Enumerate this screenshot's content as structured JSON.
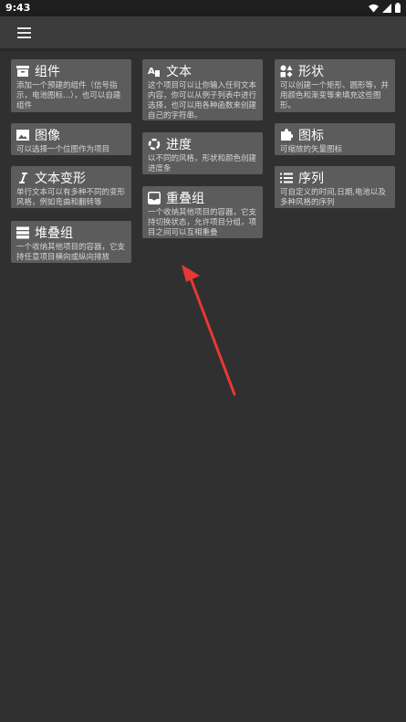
{
  "status": {
    "time": "9:43"
  },
  "cards": {
    "components": {
      "title": "组件",
      "desc": "添加一个预建的组件（信号指示，电池图标...），也可以自建组件"
    },
    "image": {
      "title": "图像",
      "desc": "可以选择一个位图作为项目"
    },
    "text_transform": {
      "title": "文本变形",
      "desc": "单行文本可以有多种不同的变形风格，例如弯曲和翻转等"
    },
    "stack": {
      "title": "堆叠组",
      "desc": "一个收纳其他项目的容器，它支持任意项目横向或纵向排放"
    },
    "text": {
      "title": "文本",
      "desc": "这个项目可以让你输入任何文本内容，你可以从例子列表中进行选择，也可以用各种函数来创建自己的字符串。"
    },
    "progress": {
      "title": "进度",
      "desc": "以不同的风格，形状和颜色创建进度条"
    },
    "overlap": {
      "title": "重叠组",
      "desc": "一个收纳其他项目的容器，它支持切换状态，允许项目分组，项目之间可以互相重叠"
    },
    "shape": {
      "title": "形状",
      "desc": "可以创建一个矩形、圆形等，并用颜色和渐变等来填充这些图形。"
    },
    "icon": {
      "title": "图标",
      "desc": "可缩放的矢量图标"
    },
    "sequence": {
      "title": "序列",
      "desc": "可自定义的时间,日期,电池以及多种风格的序列"
    }
  },
  "colors": {
    "background": "#303030",
    "card": "#5c5c5c",
    "arrow": "#e53935"
  }
}
